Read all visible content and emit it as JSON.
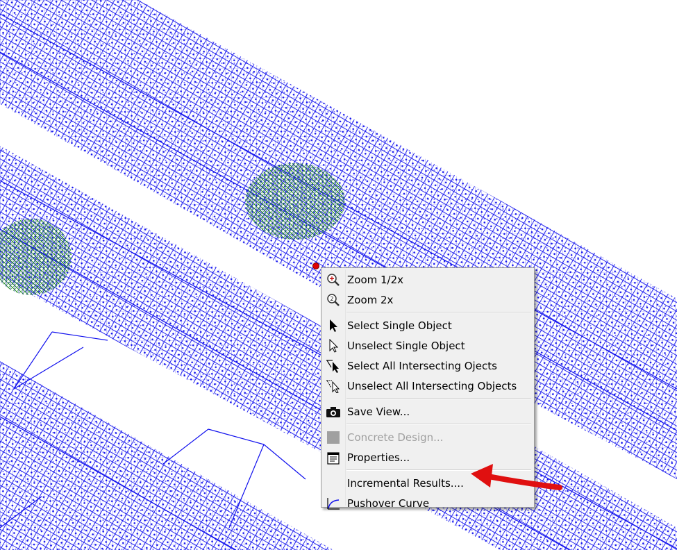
{
  "colors": {
    "mesh": "#1010ee",
    "springs": "#1a8a1a",
    "annotation_arrow": "#e01010",
    "menu_bg": "#f0f0f0"
  },
  "context_menu": {
    "items": [
      {
        "label": "Zoom 1/2x",
        "icon": "zoom-half-icon",
        "enabled": true
      },
      {
        "label": "Zoom 2x",
        "icon": "zoom-2x-icon",
        "enabled": true
      },
      {
        "label": "Select Single Object",
        "icon": "select-arrow-icon",
        "enabled": true
      },
      {
        "label": "Unselect Single Object",
        "icon": "unselect-arrow-icon",
        "enabled": true
      },
      {
        "label": "Select All Intersecting Ojects",
        "icon": "select-intersect-icon",
        "enabled": true
      },
      {
        "label": "Unselect All Intersecting Objects",
        "icon": "unselect-intersect-icon",
        "enabled": true
      },
      {
        "label": "Save View...",
        "icon": "camera-icon",
        "enabled": true
      },
      {
        "label": "Concrete Design...",
        "icon": "concrete-design-icon",
        "enabled": false
      },
      {
        "label": "Properties...",
        "icon": "properties-icon",
        "enabled": true
      },
      {
        "label": "Incremental Results....",
        "icon": "",
        "enabled": true
      },
      {
        "label": "Pushover Curve",
        "icon": "pushover-curve-icon",
        "enabled": true
      }
    ]
  }
}
